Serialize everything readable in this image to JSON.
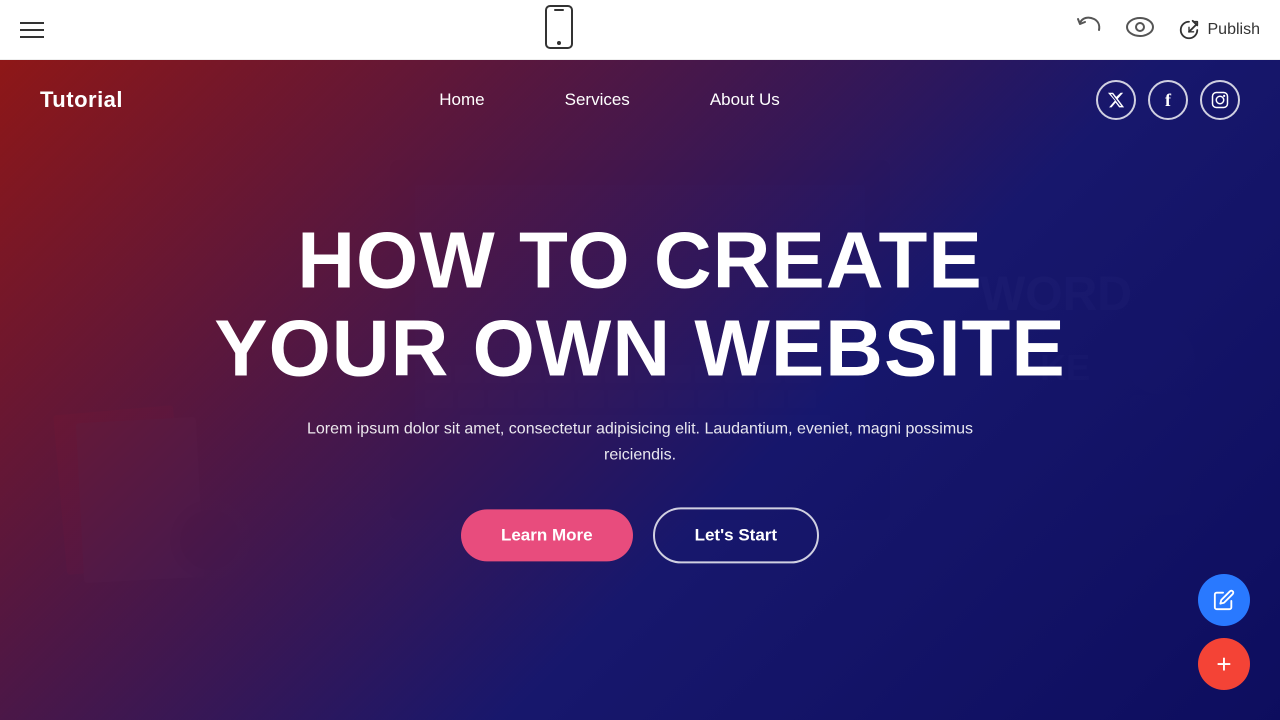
{
  "toolbar": {
    "menu_icon": "≡",
    "phone_icon": "📱",
    "undo_label": "undo-icon",
    "eye_label": "preview-icon",
    "publish_label": "Publish"
  },
  "preview": {
    "nav": {
      "logo": "Tutorial",
      "links": [
        {
          "label": "Home"
        },
        {
          "label": "Services"
        },
        {
          "label": "About Us"
        }
      ],
      "socials": [
        {
          "icon": "𝕏",
          "name": "twitter"
        },
        {
          "icon": "f",
          "name": "facebook"
        },
        {
          "icon": "📷",
          "name": "instagram"
        }
      ]
    },
    "hero": {
      "title_line1": "HOW TO CREATE",
      "title_line2": "YOUR OWN WEBSITE",
      "subtitle": "Lorem ipsum dolor sit amet, consectetur adipisicing elit. Laudantium, eveniet, magni possimus reiciendis.",
      "btn_learn_more": "Learn More",
      "btn_lets_start": "Let's Start"
    },
    "fab": {
      "edit_icon": "✏",
      "add_icon": "+"
    }
  }
}
